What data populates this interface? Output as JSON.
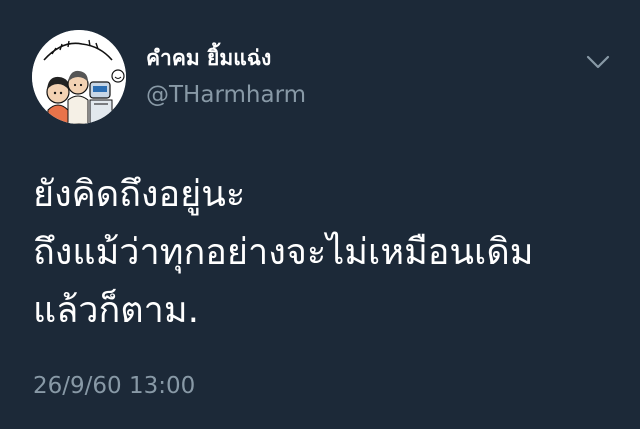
{
  "tweet": {
    "avatar_icon": "cartoon-avatar-icon",
    "avatar_text": "คำคม ยิ้มแฉ่ง",
    "display_name": "คำคม ยิ้มแฉ่ง",
    "handle": "@THarmharm",
    "menu_icon": "chevron-down-icon",
    "body_lines": [
      "ยังคิดถึงอยู่นะ",
      "ถึงแม้ว่าทุกอย่างจะไม่เหมือนเดิม",
      "แล้วก็ตาม."
    ],
    "timestamp": "26/9/60 13:00"
  },
  "colors": {
    "background": "#1c2938",
    "primary_text": "#ffffff",
    "secondary_text": "#8899a6"
  }
}
